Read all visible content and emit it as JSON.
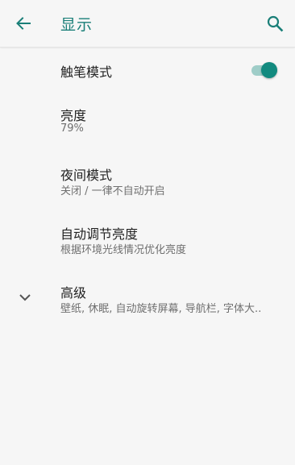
{
  "header": {
    "title": "显示",
    "back_icon": "arrow-left-icon",
    "search_icon": "search-icon"
  },
  "settings": {
    "touch_pen": {
      "label": "触笔模式",
      "enabled": true
    },
    "brightness": {
      "label": "亮度",
      "summary": "79%"
    },
    "night_mode": {
      "label": "夜间模式",
      "summary": "关闭 / 一律不自动开启"
    },
    "adaptive_brightness": {
      "label": "自动调节亮度",
      "summary": "根据环境光线情况优化亮度"
    },
    "advanced": {
      "label": "高级",
      "summary": "壁纸, 休眠, 自动旋转屏幕, 导航栏, 字体大..",
      "icon": "chevron-down-icon"
    }
  },
  "colors": {
    "accent": "#1a7f78",
    "switch_thumb": "#128a7f",
    "switch_track": "#9fcdc8",
    "background": "#f6f6f6"
  }
}
